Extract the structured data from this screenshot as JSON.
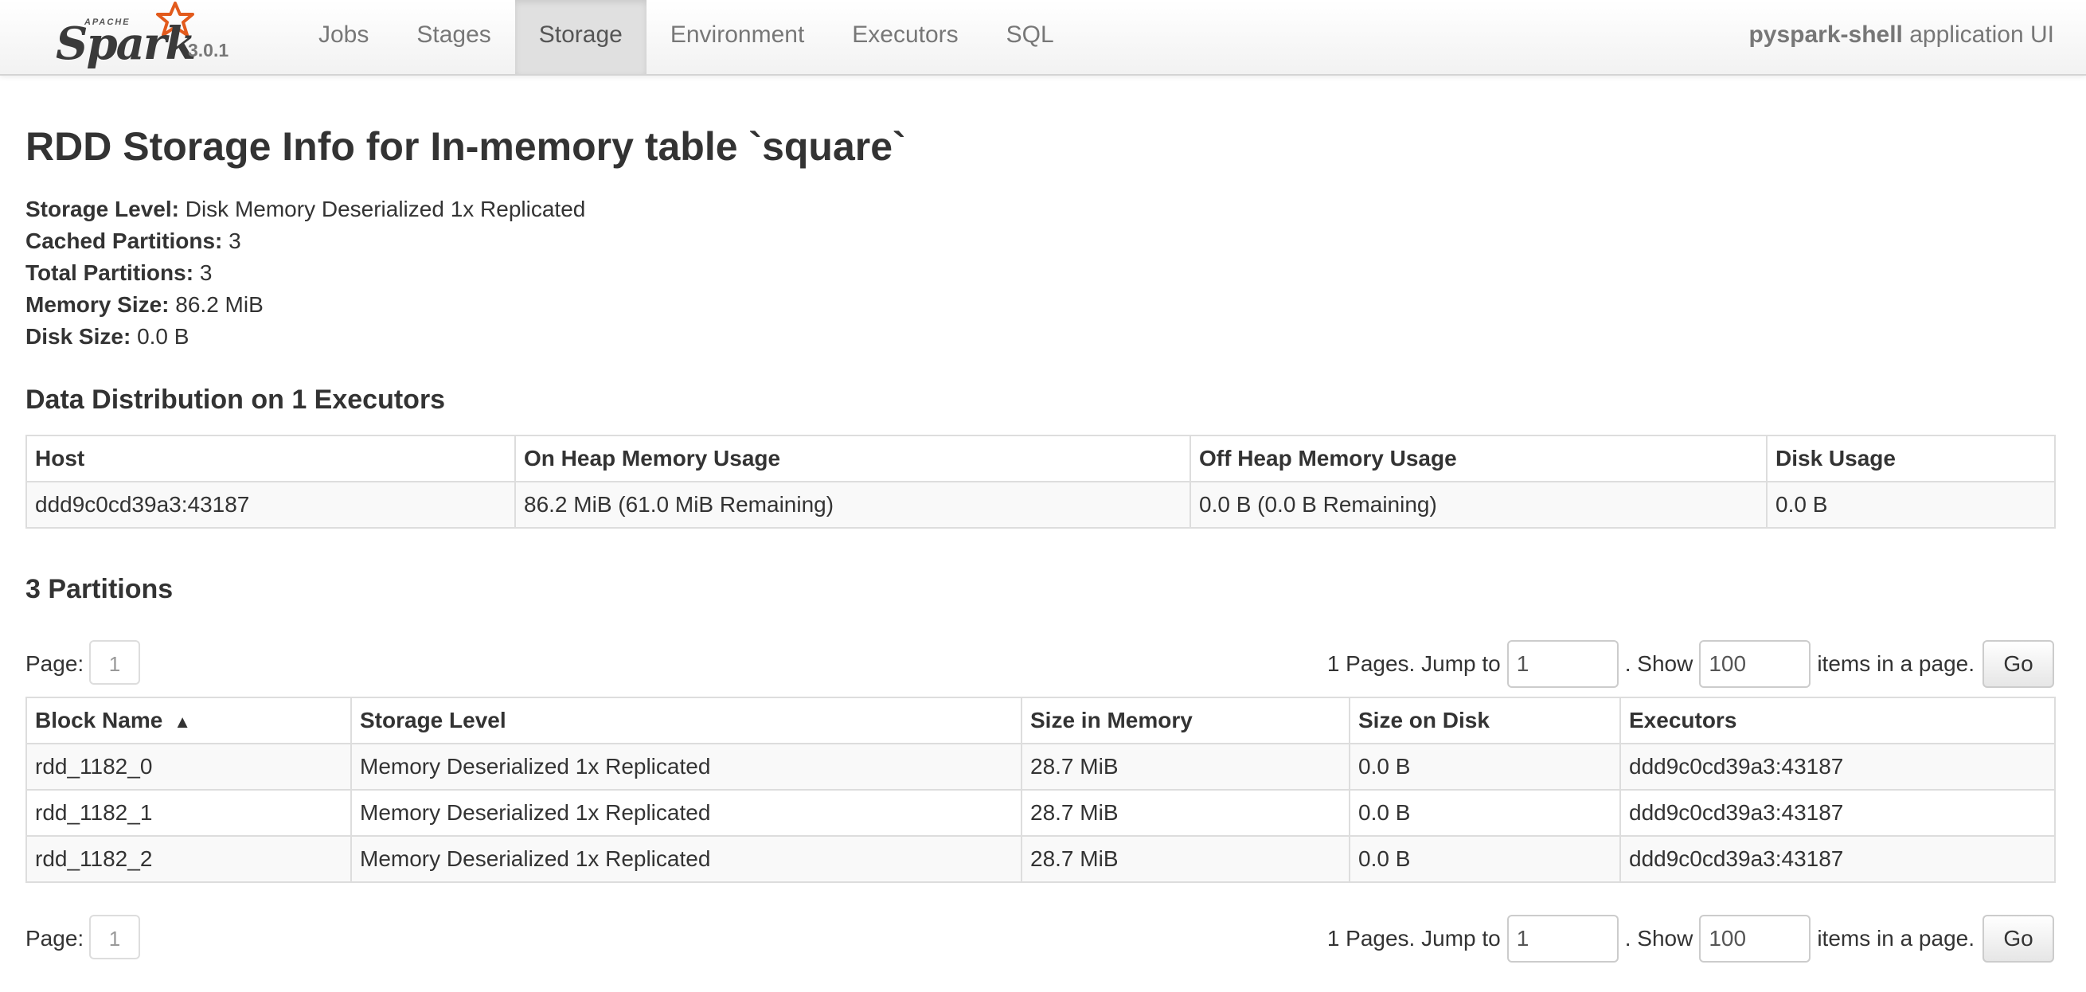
{
  "navbar": {
    "brand_apache": "APACHE",
    "brand_name": "Spark",
    "version": "3.0.1",
    "tabs": [
      {
        "label": "Jobs"
      },
      {
        "label": "Stages"
      },
      {
        "label": "Storage",
        "active": true
      },
      {
        "label": "Environment"
      },
      {
        "label": "Executors"
      },
      {
        "label": "SQL"
      }
    ],
    "app_name": "pyspark-shell",
    "app_suffix": "application UI"
  },
  "page": {
    "title": "RDD Storage Info for In-memory table `square`",
    "summary": [
      {
        "label": "Storage Level:",
        "value": "Disk Memory Deserialized 1x Replicated"
      },
      {
        "label": "Cached Partitions:",
        "value": "3"
      },
      {
        "label": "Total Partitions:",
        "value": "3"
      },
      {
        "label": "Memory Size:",
        "value": "86.2 MiB"
      },
      {
        "label": "Disk Size:",
        "value": "0.0 B"
      }
    ]
  },
  "distribution": {
    "heading": "Data Distribution on 1 Executors",
    "columns": [
      "Host",
      "On Heap Memory Usage",
      "Off Heap Memory Usage",
      "Disk Usage"
    ],
    "rows": [
      [
        "ddd9c0cd39a3:43187",
        "86.2 MiB (61.0 MiB Remaining)",
        "0.0 B (0.0 B Remaining)",
        "0.0 B"
      ]
    ]
  },
  "partitions": {
    "heading": "3 Partitions",
    "columns": [
      "Block Name",
      "Storage Level",
      "Size in Memory",
      "Size on Disk",
      "Executors"
    ],
    "sort_indicator": "▲",
    "rows": [
      [
        "rdd_1182_0",
        "Memory Deserialized 1x Replicated",
        "28.7 MiB",
        "0.0 B",
        "ddd9c0cd39a3:43187"
      ],
      [
        "rdd_1182_1",
        "Memory Deserialized 1x Replicated",
        "28.7 MiB",
        "0.0 B",
        "ddd9c0cd39a3:43187"
      ],
      [
        "rdd_1182_2",
        "Memory Deserialized 1x Replicated",
        "28.7 MiB",
        "0.0 B",
        "ddd9c0cd39a3:43187"
      ]
    ]
  },
  "pager": {
    "page_label": "Page:",
    "current_page": "1",
    "pages_text": "1 Pages. Jump to",
    "jump_value": "1",
    "show_label": ". Show",
    "show_value": "100",
    "items_label": "items in a page.",
    "go_label": "Go"
  }
}
